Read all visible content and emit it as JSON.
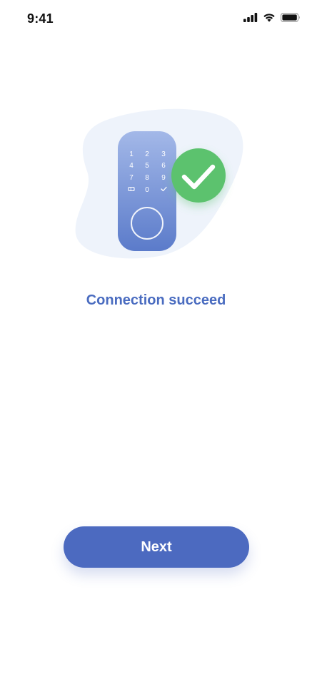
{
  "status_bar": {
    "time": "9:41",
    "icons": [
      "signal-icon",
      "wifi-icon",
      "battery-icon"
    ]
  },
  "illustration": {
    "keypad": [
      "1",
      "2",
      "3",
      "4",
      "5",
      "6",
      "7",
      "8",
      "9",
      "",
      "0",
      ""
    ],
    "keypad_special_icons": [
      "card-icon",
      "check-small-icon"
    ],
    "badge_icon": "check-icon",
    "colors": {
      "blob": "#eef3fb",
      "lock_top": "#9fb5e6",
      "lock_bottom": "#5f7fcc",
      "badge": "#5cc26e"
    }
  },
  "main": {
    "headline": "Connection succeed"
  },
  "footer": {
    "next_label": "Next"
  },
  "colors": {
    "accent": "#4a6cc0",
    "button": "#4c6ac0"
  }
}
